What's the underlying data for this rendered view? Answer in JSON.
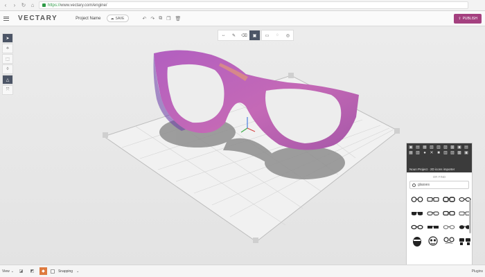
{
  "browser": {
    "url_scheme": "https://",
    "url_rest": "www.vectary.com/engine/"
  },
  "header": {
    "logo": "VECTARY",
    "project_name": "Project Name",
    "save_label": "SAVE",
    "publish_label": "PUBLISH"
  },
  "left_tools": [
    "select-icon",
    "vertex-icon",
    "cube-icon",
    "drop-icon",
    "triangle-icon",
    "transform-icon"
  ],
  "top_tools": [
    "move-icon",
    "pen-icon",
    "eraser-icon",
    "box-select-icon",
    "rect-select-icon",
    "lasso-icon",
    "target-icon"
  ],
  "panel": {
    "preview_title": "Noun Project · 2D icons importer",
    "divider": "OR FIND",
    "search_value": "glasses",
    "footer": "Noun Project - 2D icons importer"
  },
  "bottom": {
    "view_label": "View",
    "snapping_label": "Snapping",
    "plugins_label": "Plugins"
  },
  "colors": {
    "accent": "#a4407f",
    "glasses": "#c068b4",
    "active_tool": "#4c5566"
  }
}
